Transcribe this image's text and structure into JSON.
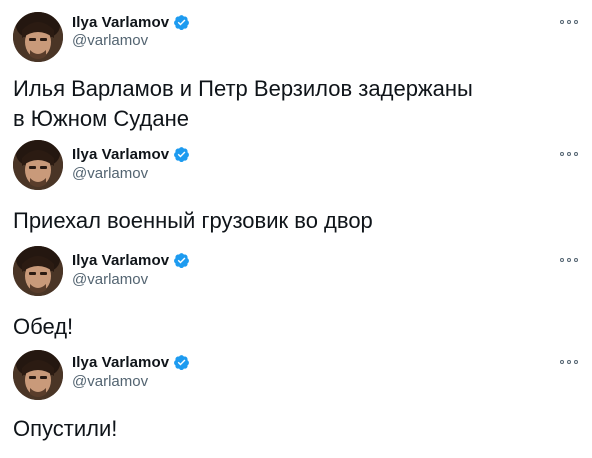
{
  "tweets": [
    {
      "author": {
        "name": "Ilya Varlamov",
        "handle": "@varlamov",
        "avatar_icon": "avatar-photo-icon",
        "verified_icon": "verified-badge-icon"
      },
      "more_icon": "more-options-icon",
      "lines": [
        "Илья Варламов и Петр Верзилов задержаны",
        "в Южном Судане"
      ]
    },
    {
      "author": {
        "name": "Ilya Varlamov",
        "handle": "@varlamov",
        "avatar_icon": "avatar-photo-icon",
        "verified_icon": "verified-badge-icon"
      },
      "more_icon": "more-options-icon",
      "lines": [
        "Приехал военный грузовик во двор"
      ]
    },
    {
      "author": {
        "name": "Ilya Varlamov",
        "handle": "@varlamov",
        "avatar_icon": "avatar-photo-icon",
        "verified_icon": "verified-badge-icon"
      },
      "more_icon": "more-options-icon",
      "lines": [
        "Обед!"
      ]
    },
    {
      "author": {
        "name": "Ilya Varlamov",
        "handle": "@varlamov",
        "avatar_icon": "avatar-photo-icon",
        "verified_icon": "verified-badge-icon"
      },
      "more_icon": "more-options-icon",
      "lines": [
        "Опустили!"
      ]
    }
  ],
  "colors": {
    "verified": "#1d9bf0",
    "text": "#0f1419",
    "secondary": "#536471"
  }
}
